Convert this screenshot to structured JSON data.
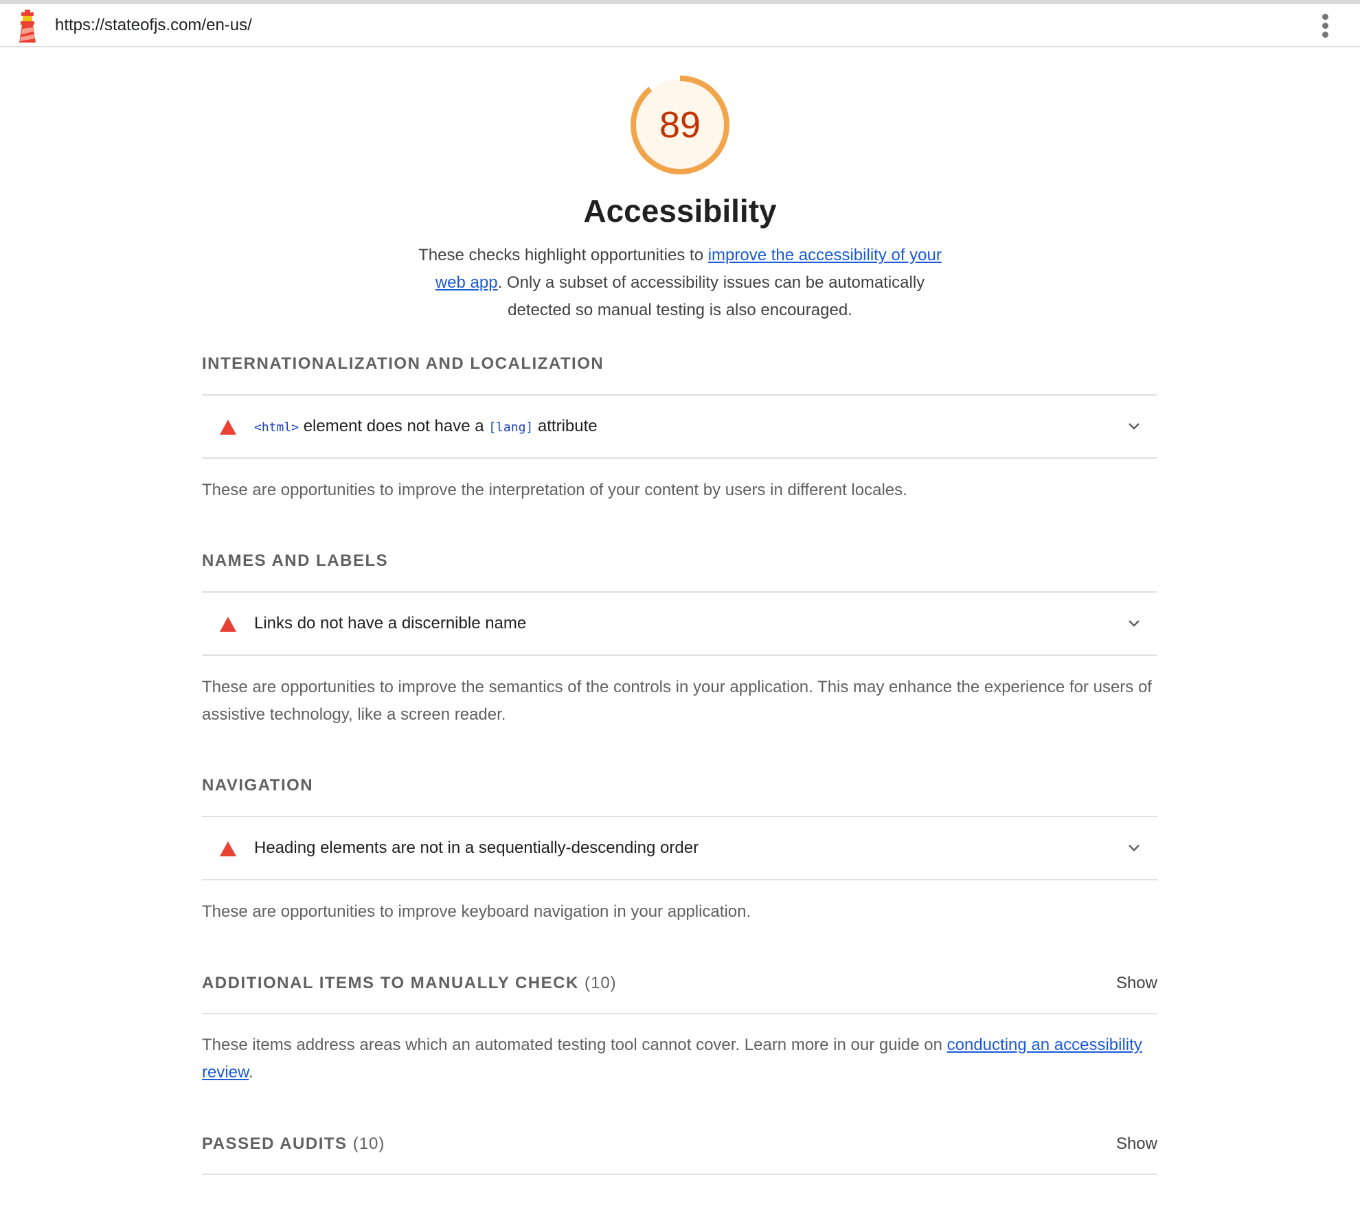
{
  "topbar": {
    "url": "https://stateofjs.com/en-us/",
    "logo_icon": "lighthouse-logo-icon",
    "menu_icon": "more-vert-icon"
  },
  "gauge": {
    "score": "89",
    "fraction": 0.89,
    "arc_color": "#f2a44a",
    "fill_color": "#fff6ec",
    "text_color": "#c33300"
  },
  "header": {
    "title": "Accessibility",
    "intro_before": "These checks highlight opportunities to ",
    "intro_link": "improve the accessibility of your web app",
    "intro_after": ". Only a subset of accessibility issues can be automatically detected so manual testing is also encouraged."
  },
  "sections": {
    "i18n": {
      "title": "INTERNATIONALIZATION AND LOCALIZATION",
      "audit": {
        "code1": "<html>",
        "text1": " element does not have a ",
        "code2": "[lang]",
        "text2": " attribute"
      },
      "description": "These are opportunities to improve the interpretation of your content by users in different locales."
    },
    "names": {
      "title": "NAMES AND LABELS",
      "audit": "Links do not have a discernible name",
      "description": "These are opportunities to improve the semantics of the controls in your application. This may enhance the experience for users of assistive technology, like a screen reader."
    },
    "navigation": {
      "title": "NAVIGATION",
      "audit": "Heading elements are not in a sequentially-descending order",
      "description": "These are opportunities to improve keyboard navigation in your application."
    },
    "manual": {
      "title": "ADDITIONAL ITEMS TO MANUALLY CHECK",
      "count": "(10)",
      "show": "Show",
      "description_before": "These items address areas which an automated testing tool cannot cover. Learn more in our guide on ",
      "description_link": "conducting an accessibility review",
      "description_after": "."
    },
    "passed": {
      "title": "PASSED AUDITS",
      "count": "(10)",
      "show": "Show"
    }
  },
  "colors": {
    "warning": "#e94235",
    "link": "#1a5bd6",
    "code": "#1a40c4"
  }
}
